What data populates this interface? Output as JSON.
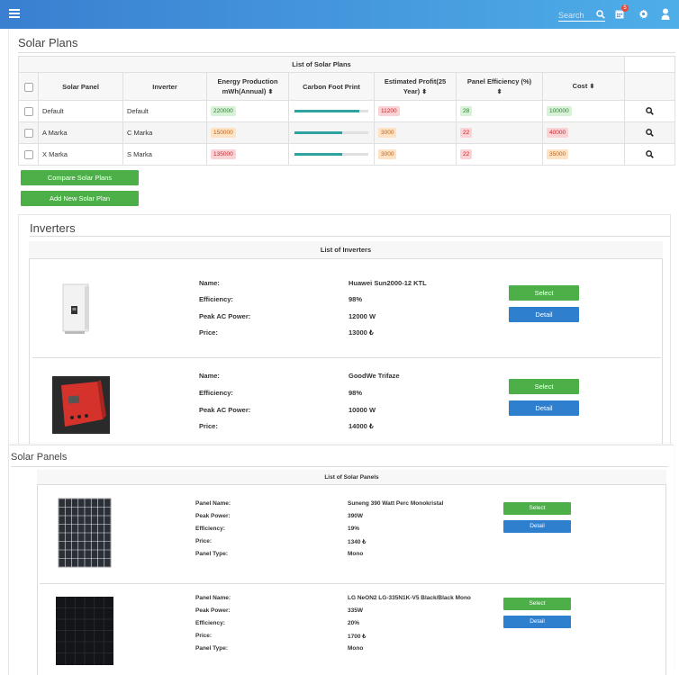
{
  "topbar": {
    "search_label": "Search",
    "notification_count": "5"
  },
  "plans": {
    "title": "Solar Plans",
    "table_caption": "List of Solar Plans",
    "columns": [
      "Solar Panel",
      "Inverter",
      "Energy Production mWh(Annual)",
      "Carbon Foot Print",
      "Estimated Profit(25 Year)",
      "Panel Efficiency (%)",
      "Cost"
    ],
    "rows": [
      {
        "panel": "Default",
        "inverter": "Default",
        "energy": "220000",
        "carbon_fraction": 0.88,
        "profit": "11200",
        "efficiency": "28",
        "cost": "100000",
        "cost_color": "green"
      },
      {
        "panel": "A Marka",
        "inverter": "C Marka",
        "energy": "150000",
        "carbon_fraction": 0.65,
        "profit": "3000",
        "efficiency": "22",
        "cost": "40000",
        "cost_color": "red"
      },
      {
        "panel": "X Marka",
        "inverter": "S Marka",
        "energy": "135000",
        "carbon_fraction": 0.65,
        "profit": "3000",
        "efficiency": "22",
        "cost": "35000",
        "cost_color": "orange"
      }
    ],
    "compare_button": "Compare Solar Plans",
    "add_button": "Add New Solar Plan"
  },
  "inverters": {
    "title": "Inverters",
    "list_caption": "List of Inverters",
    "labels": {
      "name": "Name:",
      "efficiency": "Efficiency:",
      "peak": "Peak AC Power:",
      "price": "Price:"
    },
    "items": [
      {
        "name": "Huawei Sun2000-12 KTL",
        "efficiency": "98%",
        "peak": "12000 W",
        "price": "13000 ₺"
      },
      {
        "name": "GoodWe Trifaze",
        "efficiency": "98%",
        "peak": "10000 W",
        "price": "14000 ₺"
      }
    ],
    "select_label": "Select",
    "detail_label": "Detail"
  },
  "panels": {
    "title": "Solar Panels",
    "list_caption": "List of Solar Panels",
    "labels": {
      "name": "Panel Name:",
      "power": "Peak Power:",
      "efficiency": "Efficiency:",
      "price": "Price:",
      "type": "Panel Type:"
    },
    "items": [
      {
        "name": "Suneng 390 Watt Perc Monokristal",
        "power": "390W",
        "efficiency": "19%",
        "price": "1340 ₺",
        "type": "Mono"
      },
      {
        "name": "LG NeON2 LG-335N1K-V5 Black/Black Mono",
        "power": "335W",
        "efficiency": "20%",
        "price": "1700 ₺",
        "type": "Mono"
      }
    ],
    "select_label": "Select",
    "detail_label": "Detail"
  },
  "colors": {
    "accent": "#3a7fd0",
    "green_button": "#4caf48",
    "blue_button": "#2f7fcf",
    "bar": "#2fa3a0"
  }
}
